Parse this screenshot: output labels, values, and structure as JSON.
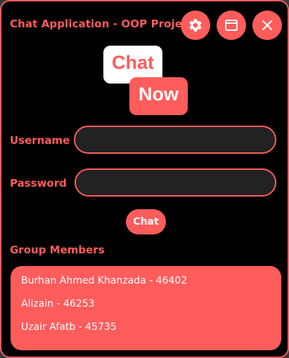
{
  "window": {
    "title": "Chat Application - OOP Project",
    "buttons": [
      "gear-icon",
      "maximize-icon",
      "close-icon"
    ]
  },
  "logo": {
    "word1": "Chat",
    "word2": "Now"
  },
  "form": {
    "username_label": "Username",
    "username_value": "",
    "password_label": "Password",
    "password_value": "",
    "submit_label": "Chat"
  },
  "group": {
    "heading": "Group Members",
    "members": [
      "Burhan Ahmed Khanzada - 46402",
      "Alizain - 46253",
      "Uzair Afatb - 45735"
    ]
  },
  "colors": {
    "accent": "#ff5c5c",
    "background": "#000000",
    "field_background": "#222222",
    "text_light": "#ffffff"
  }
}
